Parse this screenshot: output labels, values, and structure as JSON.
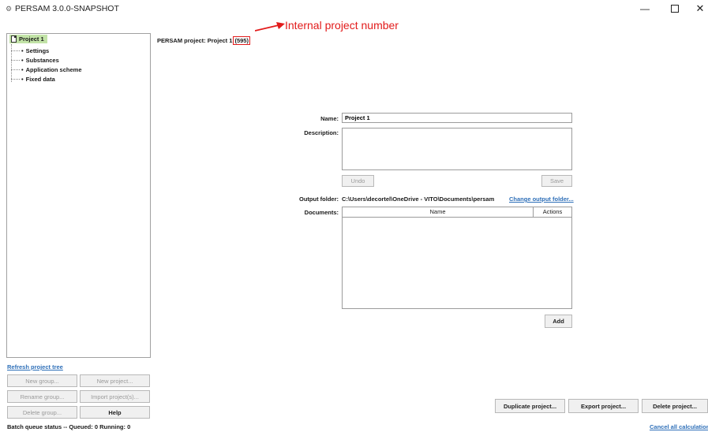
{
  "window": {
    "title": "PERSAM 3.0.0-SNAPSHOT",
    "icon": "app-gear-icon",
    "controls": [
      "minimize-icon",
      "maximize-icon",
      "close-icon"
    ]
  },
  "tree": {
    "root": "Project 1",
    "items": [
      "Settings",
      "Substances",
      "Application scheme",
      "Fixed data"
    ]
  },
  "left_panel": {
    "refresh_link": "Refresh project tree",
    "buttons": {
      "new_group": "New group...",
      "new_project": "New project...",
      "rename_group": "Rename group...",
      "import_projects": "Import project(s)...",
      "delete_group": "Delete group...",
      "help": "Help"
    }
  },
  "header": {
    "prefix": "PERSAM project: Project 1",
    "project_id": "(595)"
  },
  "annotation": {
    "text": "Internal project number",
    "color": "#e21b1b"
  },
  "form": {
    "name_label": "Name:",
    "name_value": "Project 1",
    "description_label": "Description:",
    "description_value": "",
    "undo": "Undo",
    "save": "Save",
    "output_folder_label": "Output folder:",
    "output_folder_path": "C:\\Users\\decortel\\OneDrive - VITO\\Documents\\persam",
    "change_output_folder": "Change output folder...",
    "documents_label": "Documents:",
    "documents_columns": [
      "Name",
      "Actions"
    ],
    "add": "Add"
  },
  "actions": {
    "duplicate": "Duplicate project...",
    "export": "Export project...",
    "delete": "Delete project..."
  },
  "status": {
    "batch_queue": "Batch queue status -- Queued: 0  Running: 0",
    "cancel_all": "Cancel all calculations"
  },
  "colors": {
    "tree_selection": "#c2e3a7",
    "link": "#2e6fb8"
  }
}
